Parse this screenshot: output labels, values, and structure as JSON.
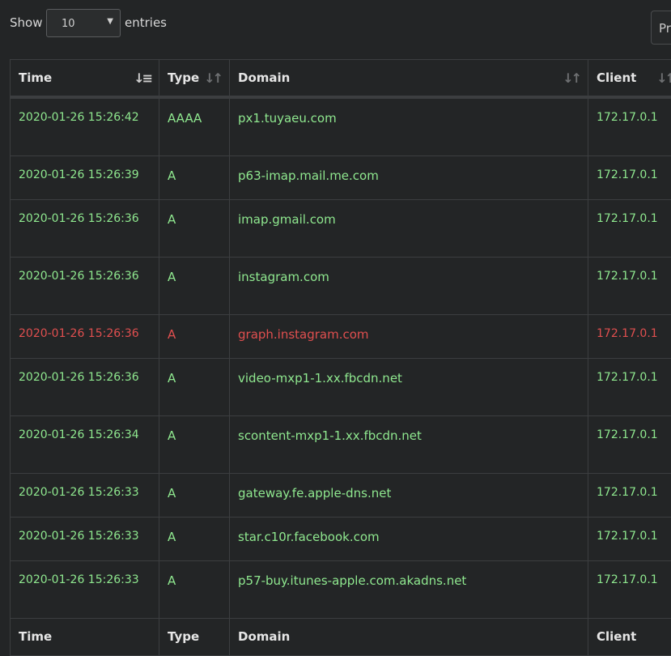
{
  "length_menu": {
    "show_label": "Show",
    "selected": "10",
    "entries_label": "entries"
  },
  "pagination": {
    "previous_label": "Pr"
  },
  "columns": [
    {
      "label": "Time"
    },
    {
      "label": "Type"
    },
    {
      "label": "Domain"
    },
    {
      "label": "Client"
    }
  ],
  "rows": [
    {
      "time": "2020-01-26 15:26:42",
      "type": "AAAA",
      "domain": "px1.tuyaeu.com",
      "client": "172.17.0.1",
      "status": "allowed"
    },
    {
      "time": "2020-01-26 15:26:39",
      "type": "A",
      "domain": "p63-imap.mail.me.com",
      "client": "172.17.0.1",
      "status": "allowed"
    },
    {
      "time": "2020-01-26 15:26:36",
      "type": "A",
      "domain": "imap.gmail.com",
      "client": "172.17.0.1",
      "status": "allowed"
    },
    {
      "time": "2020-01-26 15:26:36",
      "type": "A",
      "domain": "instagram.com",
      "client": "172.17.0.1",
      "status": "allowed"
    },
    {
      "time": "2020-01-26 15:26:36",
      "type": "A",
      "domain": "graph.instagram.com",
      "client": "172.17.0.1",
      "status": "blocked"
    },
    {
      "time": "2020-01-26 15:26:36",
      "type": "A",
      "domain": "video-mxp1-1.xx.fbcdn.net",
      "client": "172.17.0.1",
      "status": "allowed"
    },
    {
      "time": "2020-01-26 15:26:34",
      "type": "A",
      "domain": "scontent-mxp1-1.xx.fbcdn.net",
      "client": "172.17.0.1",
      "status": "allowed"
    },
    {
      "time": "2020-01-26 15:26:33",
      "type": "A",
      "domain": "gateway.fe.apple-dns.net",
      "client": "172.17.0.1",
      "status": "allowed"
    },
    {
      "time": "2020-01-26 15:26:33",
      "type": "A",
      "domain": "star.c10r.facebook.com",
      "client": "172.17.0.1",
      "status": "allowed"
    },
    {
      "time": "2020-01-26 15:26:33",
      "type": "A",
      "domain": "p57-buy.itunes-apple.com.akadns.net",
      "client": "172.17.0.1",
      "status": "allowed"
    }
  ],
  "colors": {
    "allowed": "#8fe88f",
    "blocked": "#e04f4f",
    "background": "#232526"
  }
}
